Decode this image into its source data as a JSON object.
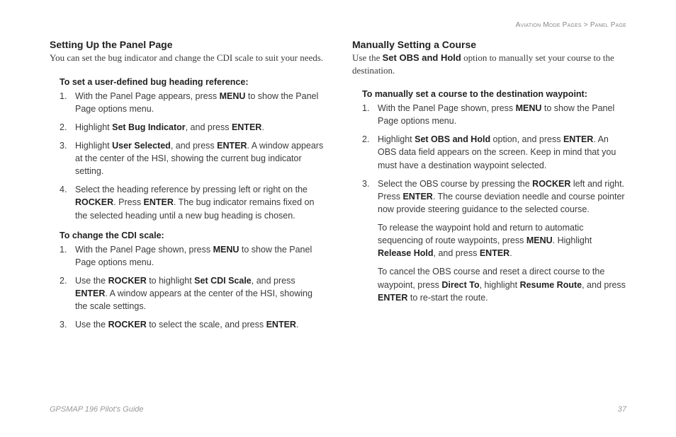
{
  "header": {
    "breadcrumb1": "Aviation Mode Pages",
    "sep": " > ",
    "breadcrumb2": "Panel Page"
  },
  "left": {
    "title": "Setting Up the Panel Page",
    "intro": "You can set the bug indicator and change the CDI scale to suit your needs.",
    "sub1": "To set a user-defined bug heading reference:",
    "s1a": "With the Panel Page appears, press ",
    "s1b": " to show the Panel Page options menu.",
    "s2a": "Highlight ",
    "s2b": ", and press ",
    "s2c": ".",
    "s3a": "Highlight ",
    "s3b": ", and press ",
    "s3c": ". A window appears at the center of the HSI, showing the current bug indicator setting.",
    "s4a": "Select the heading reference by pressing left or right on the ",
    "s4b": ". Press ",
    "s4c": ". The bug indicator remains fixed on the selected heading until a new bug heading is chosen.",
    "sub2": "To change the CDI scale:",
    "c1a": "With the Panel Page shown, press ",
    "c1b": " to show the Panel Page options menu.",
    "c2a": "Use the ",
    "c2b": " to highlight ",
    "c2c": ", and press ",
    "c2d": ". A window appears at the center of the HSI, showing the scale settings.",
    "c3a": "Use the ",
    "c3b": " to select the scale, and press ",
    "c3c": ".",
    "kw": {
      "menu": "MENU",
      "setBug": "Set Bug Indicator",
      "enter": "ENTER",
      "userSel": "User Selected",
      "rocker": "ROCKER",
      "setCdi": "Set CDI Scale"
    }
  },
  "right": {
    "title": "Manually Setting a Course",
    "introA": "Use the ",
    "introB": " option to manually set your course to the destination.",
    "introKw": "Set OBS and Hold",
    "sub1": "To manually set a course to the destination waypoint:",
    "m1a": "With the Panel Page shown, press ",
    "m1b": " to show the Panel Page options menu.",
    "m2a": "Highlight ",
    "m2b": " option, and press ",
    "m2c": ". An OBS data field appears on the screen. Keep in mind that you must have a destination waypoint selected.",
    "m3a": "Select the OBS course by pressing the ",
    "m3b": " left and right. Press ",
    "m3c": ". The course deviation needle and course pointer now provide steering guidance to the selected course.",
    "p1a": "To release the waypoint hold and return to automatic sequencing of route waypoints, press ",
    "p1b": ". Highlight ",
    "p1c": ", and press ",
    "p1d": ".",
    "p2a": "To cancel the OBS course and reset a direct course to the waypoint, press ",
    "p2b": ", highlight ",
    "p2c": ", and press ",
    "p2d": " to re-start the route.",
    "kw": {
      "menu": "MENU",
      "setObs": "Set OBS and Hold",
      "enter": "ENTER",
      "rocker": "ROCKER",
      "release": "Release Hold",
      "directTo": "Direct To",
      "resume": "Resume Route"
    }
  },
  "footer": {
    "left": "GPSMAP 196 Pilot's Guide",
    "right": "37"
  }
}
